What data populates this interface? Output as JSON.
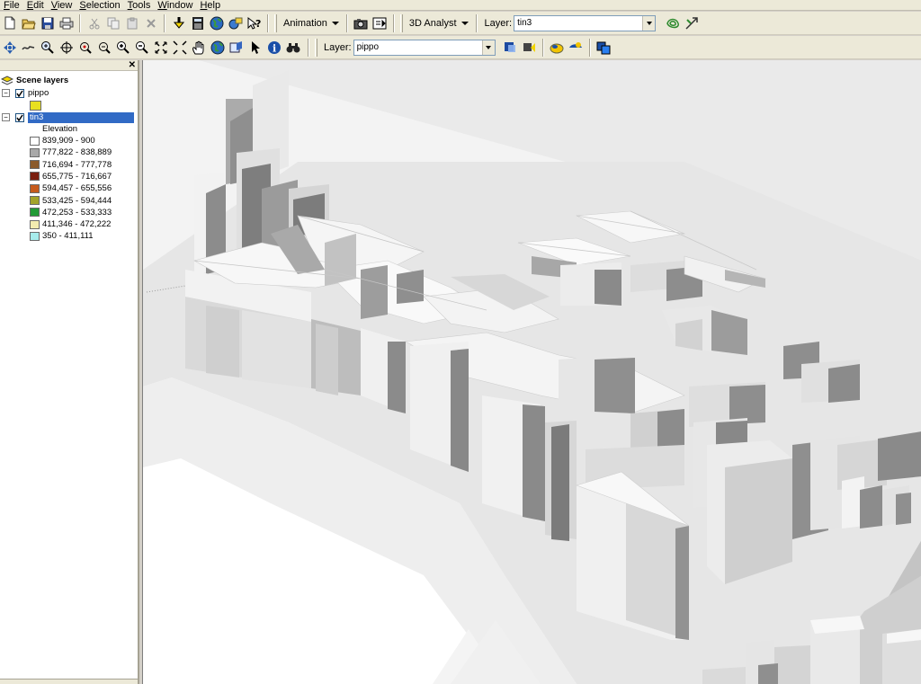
{
  "menubar": {
    "items": [
      {
        "label": "File",
        "u": "F",
        "rest": "ile"
      },
      {
        "label": "Edit",
        "u": "E",
        "rest": "dit"
      },
      {
        "label": "View",
        "u": "V",
        "rest": "iew"
      },
      {
        "label": "Selection",
        "u": "S",
        "rest": "election"
      },
      {
        "label": "Tools",
        "u": "T",
        "rest": "ools"
      },
      {
        "label": "Window",
        "u": "W",
        "rest": "indow"
      },
      {
        "label": "Help",
        "u": "H",
        "rest": "elp"
      }
    ]
  },
  "toolbar1": {
    "animation_label": "Animation",
    "analyst_label": "3D Analyst",
    "layer_label": "Layer:",
    "layer_value": "tin3"
  },
  "toolbar2": {
    "layer_label": "Layer:",
    "layer_value": "pippo"
  },
  "toc": {
    "root_label": "Scene layers",
    "layers": [
      {
        "name": "pippo",
        "checked": true,
        "swatch": "#e8e020"
      },
      {
        "name": "tin3",
        "checked": true,
        "selected": true
      }
    ],
    "legend_title": "Elevation",
    "legend": [
      {
        "label": "839,909 - 900",
        "color": "#ffffff"
      },
      {
        "label": "777,822 - 838,889",
        "color": "#a8a8a8"
      },
      {
        "label": "716,694 - 777,778",
        "color": "#8b5a2b"
      },
      {
        "label": "655,775 - 716,667",
        "color": "#7a1e0e"
      },
      {
        "label": "594,457 - 655,556",
        "color": "#c65a1c"
      },
      {
        "label": "533,425 - 594,444",
        "color": "#a3a32a"
      },
      {
        "label": "472,253 - 533,333",
        "color": "#219a35"
      },
      {
        "label": "411,346 - 472,222",
        "color": "#f3ecb0"
      },
      {
        "label": "350 - 411,111",
        "color": "#a7ecec"
      }
    ]
  }
}
